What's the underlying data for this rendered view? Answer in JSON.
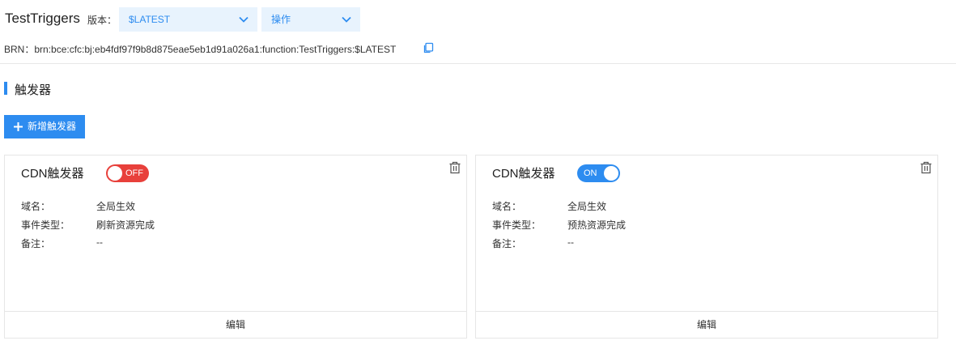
{
  "header": {
    "function_name": "TestTriggers",
    "version_label": "版本：",
    "version_select": "$LATEST",
    "operation_select": "操作",
    "brn_text": "BRN：brn:bce:cfc:bj:eb4fdf97f9b8d875eae5eb1d91a026a1:function:TestTriggers:$LATEST"
  },
  "section": {
    "title": "触发器",
    "add_button": "新增触发器"
  },
  "triggers": [
    {
      "title": "CDN触发器",
      "toggle": "OFF",
      "fields": [
        {
          "key": "域名：",
          "value": "全局生效"
        },
        {
          "key": "事件类型：",
          "value": "刷新资源完成"
        },
        {
          "key": "备注：",
          "value": "--"
        }
      ],
      "footer": "编辑"
    },
    {
      "title": "CDN触发器",
      "toggle": "ON",
      "fields": [
        {
          "key": "域名：",
          "value": "全局生效"
        },
        {
          "key": "事件类型：",
          "value": "预热资源完成"
        },
        {
          "key": "备注：",
          "value": "--"
        }
      ],
      "footer": "编辑"
    }
  ],
  "colors": {
    "accent": "#2d8cf0",
    "toggle_off": "#e8403b",
    "select_bg": "#e8f3fd"
  }
}
